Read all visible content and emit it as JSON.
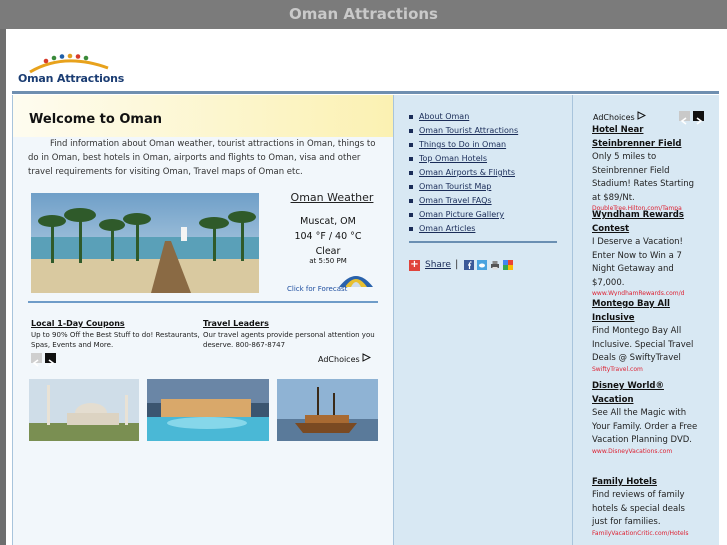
{
  "window": {
    "title": "Oman Attractions"
  },
  "logo": {
    "text": "Oman Attractions"
  },
  "main": {
    "heading": "Welcome to Oman",
    "intro": "Find information about Oman weather, tourist attractions in Oman, things to do in Oman, best hotels in Oman, airports and flights to Oman, visa and other travel requirements for visiting Oman, Travel maps of Oman etc."
  },
  "weather": {
    "title": "Oman Weather",
    "city": "Muscat, OM",
    "temp": "104 °F / 40 °C",
    "condition": "Clear",
    "time": "at 5:50 PM",
    "forecast_link": "Click for Forecast"
  },
  "ads_mid": [
    {
      "title": "Local 1-Day Coupons",
      "body": "Up to 90% Off the Best Stuff to do! Restaurants, Spas, Events and More."
    },
    {
      "title": "Travel Leaders",
      "body": "Our travel agents provide personal attention you deserve. 800-867-8747"
    }
  ],
  "adchoices_label": "AdChoices",
  "nav": [
    "About Oman",
    "Oman Tourist Attractions",
    "Things to Do in Oman",
    "Top Oman Hotels",
    "Oman Airports & Flights",
    "Oman Tourist Map",
    "Oman Travel FAQs",
    "Oman Picture Gallery",
    "Oman Articles"
  ],
  "share": {
    "label": "Share",
    "separator": "|"
  },
  "side_ads": [
    {
      "title": "Hotel Near Steinbrenner Field",
      "body": "Only 5 miles to Steinbrenner Field Stadium! Rates Starting at $89/Nt.",
      "url": "DoubleTree.Hilton.com/Tampa"
    },
    {
      "title": "Wyndham Rewards Contest",
      "body": "I Deserve a Vacation! Enter Now to Win a 7 Night Getaway and $7,000.",
      "url": "www.WyndhamRewards.com/d"
    },
    {
      "title": "Montego Bay All Inclusive",
      "body": "Find Montego Bay All Inclusive. Special Travel Deals @ SwiftyTravel",
      "url": "SwiftyTravel.com"
    },
    {
      "title": "Disney World® Vacation",
      "body": "See All the Magic with Your Family. Order a Free Vacation Planning DVD.",
      "url": "www.DisneyVacations.com"
    },
    {
      "title": "Family Hotels",
      "body": "Find reviews of family hotels & special deals just for families.",
      "url": "FamilyVacationCritic.com/Hotels"
    }
  ]
}
